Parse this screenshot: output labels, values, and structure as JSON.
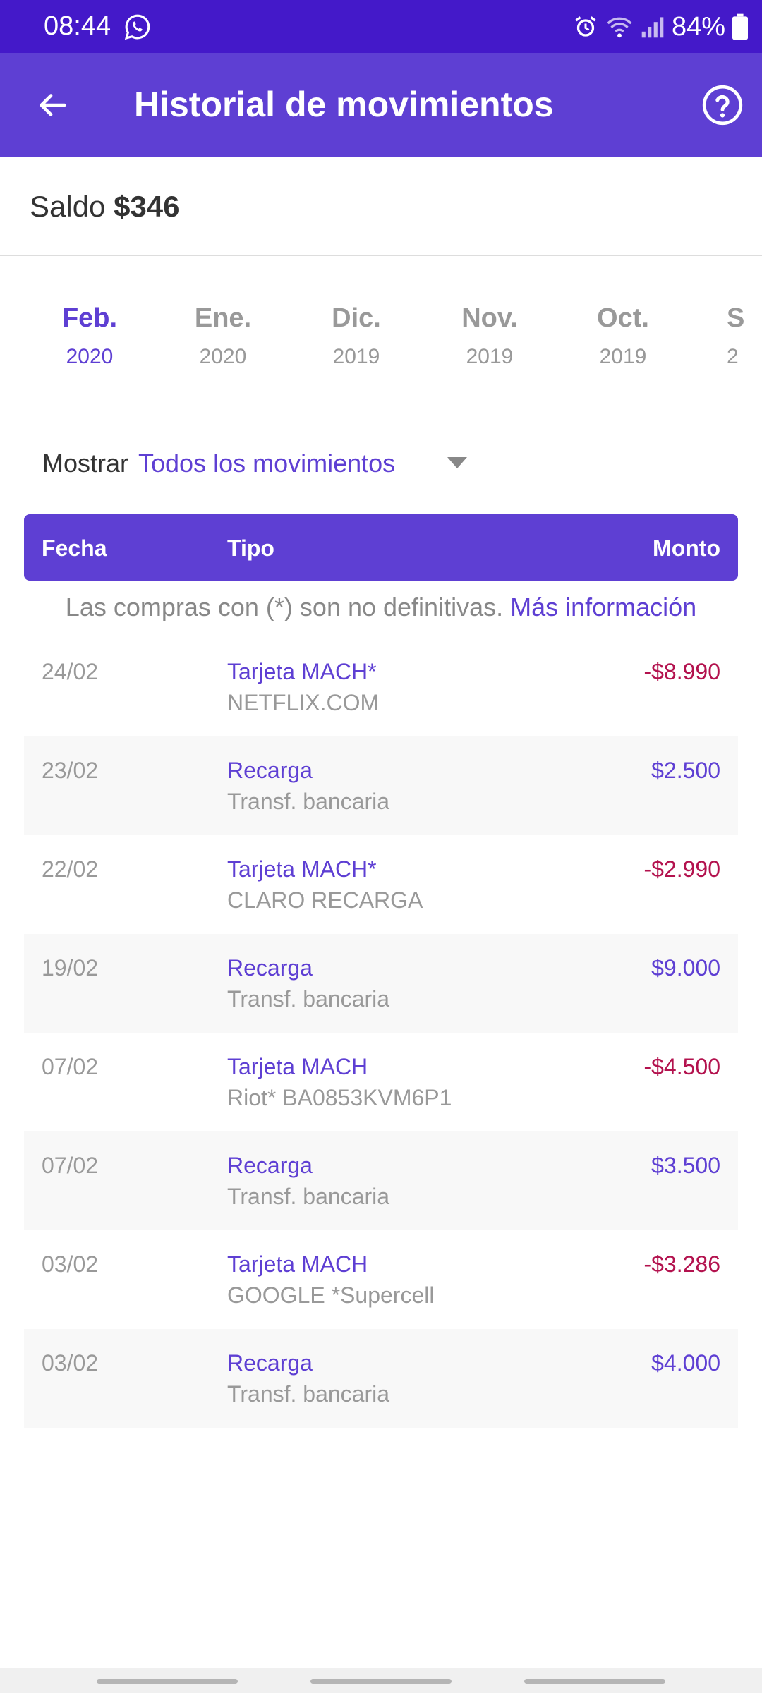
{
  "status_bar": {
    "time": "08:44",
    "battery": "84%"
  },
  "app_bar": {
    "title": "Historial de movimientos"
  },
  "balance": {
    "label": "Saldo",
    "value": "$346"
  },
  "months": [
    {
      "month": "Feb.",
      "year": "2020",
      "active": true
    },
    {
      "month": "Ene.",
      "year": "2020",
      "active": false
    },
    {
      "month": "Dic.",
      "year": "2019",
      "active": false
    },
    {
      "month": "Nov.",
      "year": "2019",
      "active": false
    },
    {
      "month": "Oct.",
      "year": "2019",
      "active": false
    },
    {
      "month": "S",
      "year": "2",
      "active": false
    }
  ],
  "filter": {
    "label": "Mostrar",
    "value": "Todos los movimientos"
  },
  "table": {
    "headers": {
      "fecha": "Fecha",
      "tipo": "Tipo",
      "monto": "Monto"
    },
    "note": "Las compras con (*) son no definitivas.",
    "note_link": "Más información",
    "rows": [
      {
        "date": "24/02",
        "type": "Tarjeta MACH*",
        "desc": "NETFLIX.COM",
        "amount": "-$8.990",
        "negative": true
      },
      {
        "date": "23/02",
        "type": "Recarga",
        "desc": "Transf. bancaria",
        "amount": "$2.500",
        "negative": false
      },
      {
        "date": "22/02",
        "type": "Tarjeta MACH*",
        "desc": "CLARO RECARGA",
        "amount": "-$2.990",
        "negative": true
      },
      {
        "date": "19/02",
        "type": "Recarga",
        "desc": "Transf. bancaria",
        "amount": "$9.000",
        "negative": false
      },
      {
        "date": "07/02",
        "type": "Tarjeta MACH",
        "desc": "Riot* BA0853KVM6P1",
        "amount": "-$4.500",
        "negative": true
      },
      {
        "date": "07/02",
        "type": "Recarga",
        "desc": "Transf. bancaria",
        "amount": "$3.500",
        "negative": false
      },
      {
        "date": "03/02",
        "type": "Tarjeta MACH",
        "desc": "GOOGLE *Supercell",
        "amount": "-$3.286",
        "negative": true
      },
      {
        "date": "03/02",
        "type": "Recarga",
        "desc": "Transf. bancaria",
        "amount": "$4.000",
        "negative": false
      }
    ]
  },
  "colors": {
    "brand": "#5e3fd3",
    "status_bar": "#4419c9",
    "negative": "#b3124e",
    "muted": "#999999"
  },
  "icons": {
    "back": "arrow-left-icon",
    "help": "help-circle-icon",
    "caret": "caret-down-icon"
  }
}
